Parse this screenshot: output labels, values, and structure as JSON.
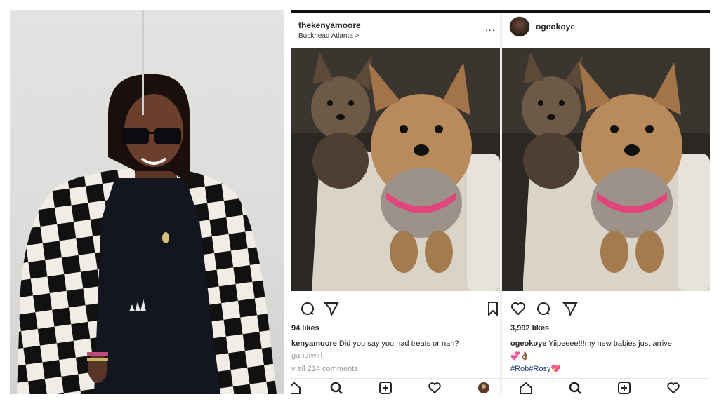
{
  "left_photo": {
    "description_icon": "portrait-photo"
  },
  "post_left": {
    "username": "thekenyamoore",
    "location": "Buckhead Atlanta >",
    "more_label": "...",
    "likes": "94 likes",
    "caption_user": "kenyamoore",
    "caption_text": "Did you say you had treats or nah?",
    "caption_line2": "gandtwirl",
    "view_comments": "v all 214 comments"
  },
  "post_right": {
    "username": "ogeokoye",
    "likes": "3,992 likes",
    "caption_user": "ogeokoye",
    "caption_text": "Yiipeeee!!!my new babies just arrive",
    "emoji_line": "💞👌🏾",
    "hashtags": "#Rob#Rosy💖"
  },
  "colors": {
    "accent_pink": "#e0457b",
    "link_blue": "#1a3d6e"
  }
}
